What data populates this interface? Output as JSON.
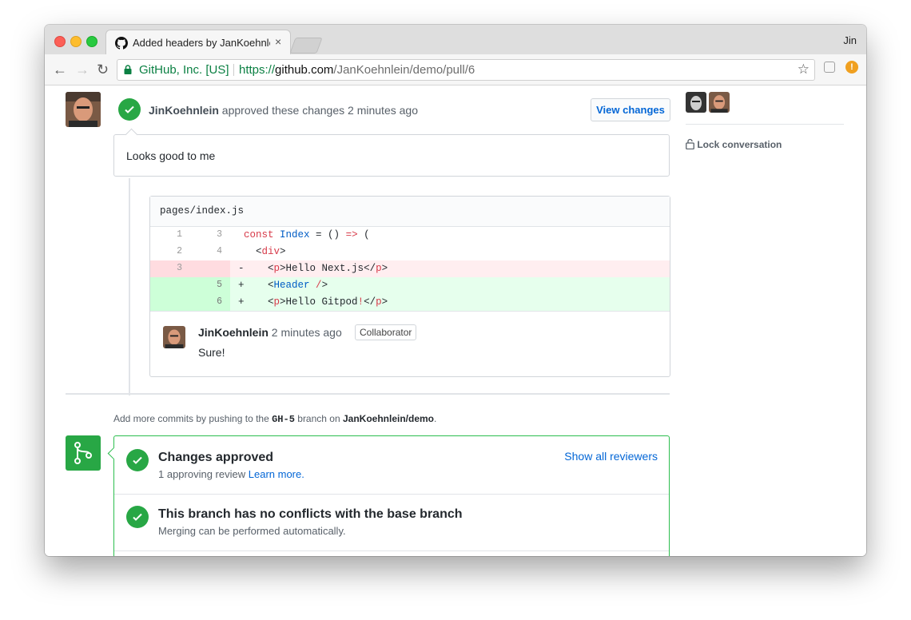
{
  "browser": {
    "tab_title": "Added headers by JanKoehnlein",
    "tab_close": "×",
    "user_name": "Jin",
    "nav": {
      "back": "←",
      "forward": "→",
      "reload": "↻"
    },
    "security_label": "GitHub, Inc. [US]",
    "url_scheme": "https://",
    "url_host": "github.com",
    "url_path": "/JanKoehnlein/demo/pull/6",
    "bookmark_star": "☆",
    "ext_badge": "!"
  },
  "review": {
    "author": "JinKoehnlein",
    "action": "approved these changes",
    "time": "2 minutes ago",
    "view_changes_label": "View changes",
    "comment": "Looks good to me"
  },
  "diff": {
    "filename": "pages/index.js",
    "rows": [
      {
        "old": "1",
        "new": "3",
        "sign": "",
        "code_kw": "const",
        "code_fn": "Index",
        "code_rest": " = () ",
        "code_kw2": "=>",
        "code_tail": " (",
        "type": "context"
      },
      {
        "old": "2",
        "new": "4",
        "sign": "",
        "type": "context"
      },
      {
        "old": "3",
        "new": "",
        "sign": "-",
        "type": "deletion"
      },
      {
        "old": "",
        "new": "5",
        "sign": "+",
        "type": "addition"
      },
      {
        "old": "",
        "new": "6",
        "sign": "+",
        "type": "addition"
      }
    ],
    "code_lines": {
      "r2_open": "<",
      "r2_tag": "div",
      "r2_close": ">",
      "r3_text": "Hello Next.js",
      "r4_tag": "Header",
      "r5_text": "Hello Gitpod",
      "r5_bang": "!"
    }
  },
  "inline_comment": {
    "author": "JinKoehnlein",
    "time": "2 minutes ago",
    "badge": "Collaborator",
    "body": "Sure!"
  },
  "push_note": {
    "prefix": "Add more commits by pushing to the",
    "branch": "GH-5",
    "middle": "branch on",
    "repo": "JanKoehnlein/demo",
    "suffix": "."
  },
  "merge": {
    "status1_title": "Changes approved",
    "status1_sub": "1 approving review",
    "status1_link": "Learn more.",
    "show_reviewers": "Show all reviewers",
    "status2_title": "This branch has no conflicts with the base branch",
    "status2_sub": "Merging can be performed automatically."
  },
  "sidebar": {
    "lock_conversation": "Lock conversation"
  },
  "colors": {
    "success": "#28a745",
    "link": "#0366d6",
    "deletion_bg": "#ffeef0",
    "addition_bg": "#e6ffed"
  }
}
